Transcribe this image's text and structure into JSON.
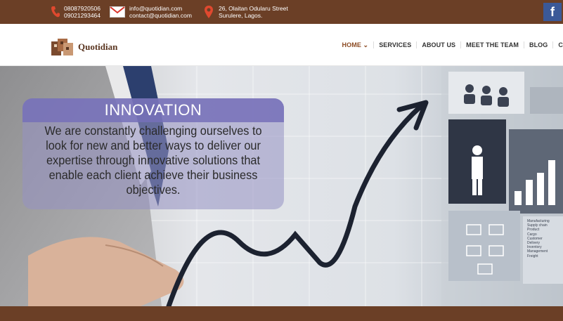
{
  "topbar": {
    "phone_1": "08087920506",
    "phone_2": "09021293464",
    "email_1": "info@quotidian.com",
    "email_2": "contact@quotidian.com",
    "address_1": "26, Olaitan Odularu Street",
    "address_2": "Surulere, Lagos.",
    "facebook_glyph": "f"
  },
  "logo": {
    "name": "Quotidian"
  },
  "nav": {
    "items": [
      {
        "label": "HOME",
        "active": true
      },
      {
        "label": "SERVICES"
      },
      {
        "label": "ABOUT US"
      },
      {
        "label": "MEET THE TEAM"
      },
      {
        "label": "BLOG"
      },
      {
        "label": "C"
      }
    ],
    "home_caret": "⌄"
  },
  "hero": {
    "title": "INNOVATION",
    "text": "We are constantly challenging ourselves to look for new and better ways to deliver our expertise through innovative solutions that enable each client achieve their business objectives.",
    "chart_list": [
      "Manufacturing",
      "Supply chain",
      "Product",
      "Cargo",
      "Customer",
      "Delivery",
      "Inventory",
      "Management",
      "Freight"
    ]
  },
  "colors": {
    "brand_brown": "#6b3f26",
    "accent": "#8b4a22",
    "facebook": "#3b5998",
    "overlay": "#7670b9"
  }
}
